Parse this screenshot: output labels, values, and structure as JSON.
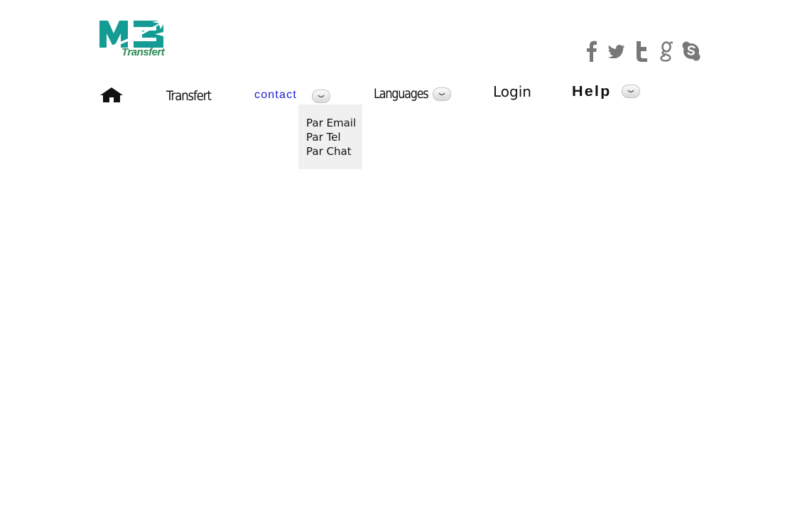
{
  "logo": {
    "mark_text": "M3",
    "text": "Transfert",
    "colors": {
      "mark": "#139b94",
      "text": "#2e8b57"
    }
  },
  "social": [
    {
      "name": "facebook-icon"
    },
    {
      "name": "twitter-icon"
    },
    {
      "name": "tumblr-icon"
    },
    {
      "name": "google-icon"
    },
    {
      "name": "skype-icon"
    }
  ],
  "nav": {
    "home_icon": "home-icon",
    "transfert": "Transfert",
    "contact": "contact",
    "languages": "Languages",
    "login": "Login",
    "help": "Help"
  },
  "contact_menu": {
    "items": [
      "Par Email",
      "Par Tel",
      "Par Chat"
    ]
  },
  "colors": {
    "contact_link": "#1a1ad6",
    "icon_gray": "#777777",
    "dropdown_bg": "#f0f0f0"
  }
}
